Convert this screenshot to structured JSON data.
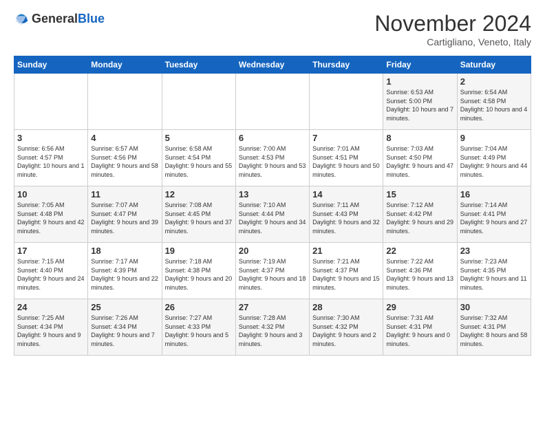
{
  "logo": {
    "general": "General",
    "blue": "Blue"
  },
  "title": "November 2024",
  "subtitle": "Cartigliano, Veneto, Italy",
  "days_of_week": [
    "Sunday",
    "Monday",
    "Tuesday",
    "Wednesday",
    "Thursday",
    "Friday",
    "Saturday"
  ],
  "weeks": [
    [
      {
        "day": "",
        "info": ""
      },
      {
        "day": "",
        "info": ""
      },
      {
        "day": "",
        "info": ""
      },
      {
        "day": "",
        "info": ""
      },
      {
        "day": "",
        "info": ""
      },
      {
        "day": "1",
        "info": "Sunrise: 6:53 AM\nSunset: 5:00 PM\nDaylight: 10 hours and 7 minutes."
      },
      {
        "day": "2",
        "info": "Sunrise: 6:54 AM\nSunset: 4:58 PM\nDaylight: 10 hours and 4 minutes."
      }
    ],
    [
      {
        "day": "3",
        "info": "Sunrise: 6:56 AM\nSunset: 4:57 PM\nDaylight: 10 hours and 1 minute."
      },
      {
        "day": "4",
        "info": "Sunrise: 6:57 AM\nSunset: 4:56 PM\nDaylight: 9 hours and 58 minutes."
      },
      {
        "day": "5",
        "info": "Sunrise: 6:58 AM\nSunset: 4:54 PM\nDaylight: 9 hours and 55 minutes."
      },
      {
        "day": "6",
        "info": "Sunrise: 7:00 AM\nSunset: 4:53 PM\nDaylight: 9 hours and 53 minutes."
      },
      {
        "day": "7",
        "info": "Sunrise: 7:01 AM\nSunset: 4:51 PM\nDaylight: 9 hours and 50 minutes."
      },
      {
        "day": "8",
        "info": "Sunrise: 7:03 AM\nSunset: 4:50 PM\nDaylight: 9 hours and 47 minutes."
      },
      {
        "day": "9",
        "info": "Sunrise: 7:04 AM\nSunset: 4:49 PM\nDaylight: 9 hours and 44 minutes."
      }
    ],
    [
      {
        "day": "10",
        "info": "Sunrise: 7:05 AM\nSunset: 4:48 PM\nDaylight: 9 hours and 42 minutes."
      },
      {
        "day": "11",
        "info": "Sunrise: 7:07 AM\nSunset: 4:47 PM\nDaylight: 9 hours and 39 minutes."
      },
      {
        "day": "12",
        "info": "Sunrise: 7:08 AM\nSunset: 4:45 PM\nDaylight: 9 hours and 37 minutes."
      },
      {
        "day": "13",
        "info": "Sunrise: 7:10 AM\nSunset: 4:44 PM\nDaylight: 9 hours and 34 minutes."
      },
      {
        "day": "14",
        "info": "Sunrise: 7:11 AM\nSunset: 4:43 PM\nDaylight: 9 hours and 32 minutes."
      },
      {
        "day": "15",
        "info": "Sunrise: 7:12 AM\nSunset: 4:42 PM\nDaylight: 9 hours and 29 minutes."
      },
      {
        "day": "16",
        "info": "Sunrise: 7:14 AM\nSunset: 4:41 PM\nDaylight: 9 hours and 27 minutes."
      }
    ],
    [
      {
        "day": "17",
        "info": "Sunrise: 7:15 AM\nSunset: 4:40 PM\nDaylight: 9 hours and 24 minutes."
      },
      {
        "day": "18",
        "info": "Sunrise: 7:17 AM\nSunset: 4:39 PM\nDaylight: 9 hours and 22 minutes."
      },
      {
        "day": "19",
        "info": "Sunrise: 7:18 AM\nSunset: 4:38 PM\nDaylight: 9 hours and 20 minutes."
      },
      {
        "day": "20",
        "info": "Sunrise: 7:19 AM\nSunset: 4:37 PM\nDaylight: 9 hours and 18 minutes."
      },
      {
        "day": "21",
        "info": "Sunrise: 7:21 AM\nSunset: 4:37 PM\nDaylight: 9 hours and 15 minutes."
      },
      {
        "day": "22",
        "info": "Sunrise: 7:22 AM\nSunset: 4:36 PM\nDaylight: 9 hours and 13 minutes."
      },
      {
        "day": "23",
        "info": "Sunrise: 7:23 AM\nSunset: 4:35 PM\nDaylight: 9 hours and 11 minutes."
      }
    ],
    [
      {
        "day": "24",
        "info": "Sunrise: 7:25 AM\nSunset: 4:34 PM\nDaylight: 9 hours and 9 minutes."
      },
      {
        "day": "25",
        "info": "Sunrise: 7:26 AM\nSunset: 4:34 PM\nDaylight: 9 hours and 7 minutes."
      },
      {
        "day": "26",
        "info": "Sunrise: 7:27 AM\nSunset: 4:33 PM\nDaylight: 9 hours and 5 minutes."
      },
      {
        "day": "27",
        "info": "Sunrise: 7:28 AM\nSunset: 4:32 PM\nDaylight: 9 hours and 3 minutes."
      },
      {
        "day": "28",
        "info": "Sunrise: 7:30 AM\nSunset: 4:32 PM\nDaylight: 9 hours and 2 minutes."
      },
      {
        "day": "29",
        "info": "Sunrise: 7:31 AM\nSunset: 4:31 PM\nDaylight: 9 hours and 0 minutes."
      },
      {
        "day": "30",
        "info": "Sunrise: 7:32 AM\nSunset: 4:31 PM\nDaylight: 8 hours and 58 minutes."
      }
    ]
  ]
}
